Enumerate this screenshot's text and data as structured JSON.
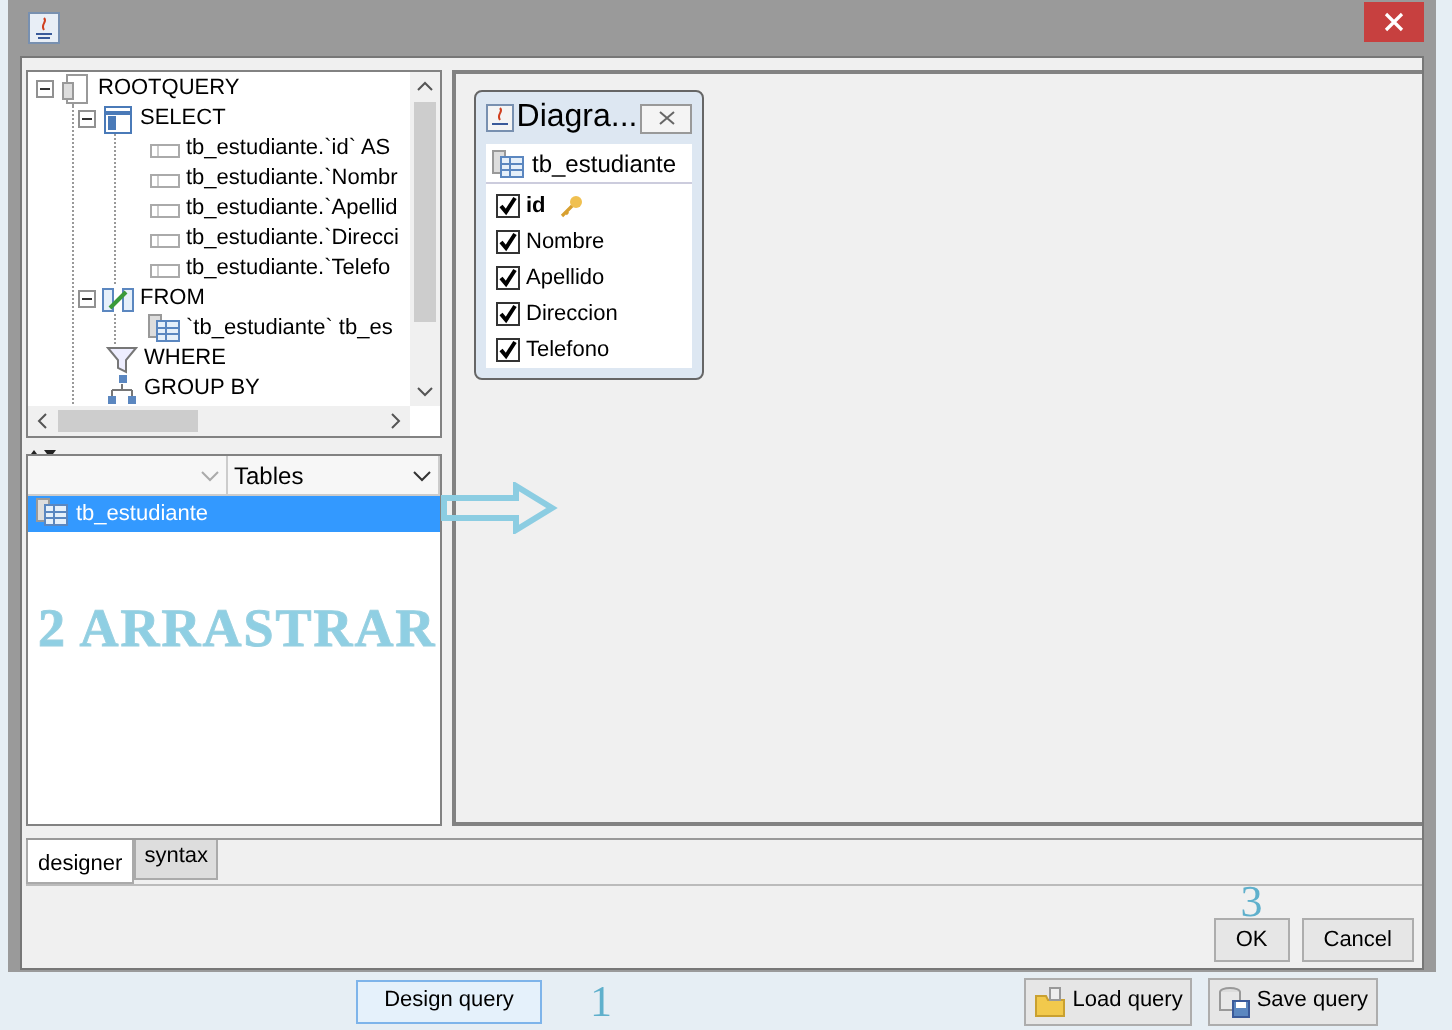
{
  "tree": [
    {
      "label": "ROOTQUERY",
      "kind": "root",
      "expanded": true,
      "children": [
        {
          "label": "SELECT",
          "kind": "select",
          "expanded": true,
          "children": [
            {
              "label": "tb_estudiante.`id` AS",
              "kind": "field"
            },
            {
              "label": "tb_estudiante.`Nombr",
              "kind": "field"
            },
            {
              "label": "tb_estudiante.`Apellid",
              "kind": "field"
            },
            {
              "label": "tb_estudiante.`Direcci",
              "kind": "field"
            },
            {
              "label": "tb_estudiante.`Telefo",
              "kind": "field"
            }
          ]
        },
        {
          "label": "FROM",
          "kind": "from",
          "expanded": true,
          "children": [
            {
              "label": "`tb_estudiante` tb_es",
              "kind": "table"
            }
          ]
        },
        {
          "label": "WHERE",
          "kind": "where"
        },
        {
          "label": "GROUP BY",
          "kind": "group"
        }
      ]
    }
  ],
  "tables_dropdown": "Tables",
  "tables": [
    {
      "label": "tb_estudiante",
      "selected": true
    }
  ],
  "diagram": {
    "title": "Diagra...",
    "table": "tb_estudiante",
    "columns": [
      {
        "name": "id",
        "key": true,
        "checked": true
      },
      {
        "name": "Nombre",
        "key": false,
        "checked": true
      },
      {
        "name": "Apellido",
        "key": false,
        "checked": true
      },
      {
        "name": "Direccion",
        "key": false,
        "checked": true
      },
      {
        "name": "Telefono",
        "key": false,
        "checked": true
      }
    ]
  },
  "tabs": [
    {
      "label": "designer",
      "selected": true
    },
    {
      "label": "syntax",
      "selected": false
    }
  ],
  "dialog_buttons": [
    "OK",
    "Cancel"
  ],
  "annotations": {
    "drag": "2 ARRASTRAR",
    "step_ok": "3",
    "step_design": "1"
  },
  "design_button": "Design query",
  "page_buttons": [
    {
      "label": "Load query",
      "kind": "load"
    },
    {
      "label": "Save query",
      "kind": "save"
    }
  ]
}
